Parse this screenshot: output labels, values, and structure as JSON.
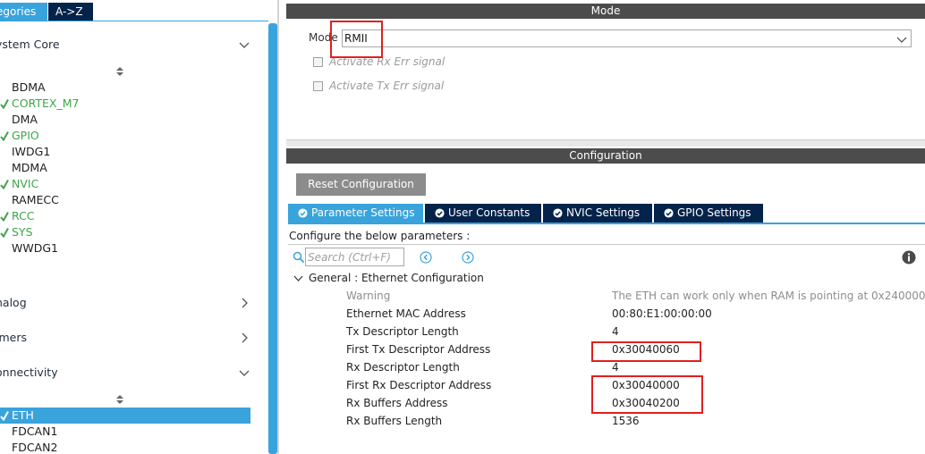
{
  "left_panel": {
    "tabs": {
      "categories": "egories",
      "atoz": "A->Z"
    },
    "groups": {
      "system_core": "ystem Core",
      "analog": "nalog",
      "timers": "imers",
      "connectivity": "onnectivity"
    },
    "system_core_items": [
      {
        "label": "BDMA",
        "ok": false
      },
      {
        "label": "CORTEX_M7",
        "ok": true
      },
      {
        "label": "DMA",
        "ok": false
      },
      {
        "label": "GPIO",
        "ok": true
      },
      {
        "label": "IWDG1",
        "ok": false
      },
      {
        "label": "MDMA",
        "ok": false
      },
      {
        "label": "NVIC",
        "ok": true
      },
      {
        "label": "RAMECC",
        "ok": false
      },
      {
        "label": "RCC",
        "ok": true
      },
      {
        "label": "SYS",
        "ok": true
      },
      {
        "label": "WWDG1",
        "ok": false
      }
    ],
    "connectivity_items": [
      {
        "label": "ETH",
        "ok": true,
        "selected": true
      },
      {
        "label": "FDCAN1",
        "ok": false
      },
      {
        "label": "FDCAN2",
        "ok": false
      }
    ]
  },
  "mode_section": {
    "header": "Mode",
    "mode_label": "Mode",
    "mode_value": "RMII",
    "checkboxes": [
      "Activate Rx Err signal",
      "Activate Tx Err signal"
    ]
  },
  "config_section": {
    "header": "Configuration",
    "reset_button": "Reset Configuration",
    "tabs": [
      "Parameter Settings",
      "User Constants",
      "NVIC Settings",
      "GPIO Settings"
    ],
    "active_tab": "Parameter Settings",
    "caption": "Configure the below parameters :",
    "search_placeholder": "Search (Ctrl+F)",
    "group_title": "General : Ethernet Configuration",
    "params": [
      {
        "name": "Warning",
        "value": "The ETH can work only when RAM is pointing at 0x240000...",
        "dim": true
      },
      {
        "name": "Ethernet MAC Address",
        "value": "00:80:E1:00:00:00"
      },
      {
        "name": "Tx Descriptor Length",
        "value": "4"
      },
      {
        "name": "First Tx Descriptor Address",
        "value": "0x30040060"
      },
      {
        "name": "Rx Descriptor Length",
        "value": "4"
      },
      {
        "name": "First Rx Descriptor Address",
        "value": "0x30040000"
      },
      {
        "name": "Rx Buffers Address",
        "value": "0x30040200"
      },
      {
        "name": "Rx Buffers Length",
        "value": "1536"
      }
    ]
  },
  "colors": {
    "accent": "#39a3dc",
    "dark_tab": "#03234b",
    "ok_green": "#3ca54a",
    "header_gray": "#4c4c4c",
    "highlight_red": "#e02020"
  }
}
